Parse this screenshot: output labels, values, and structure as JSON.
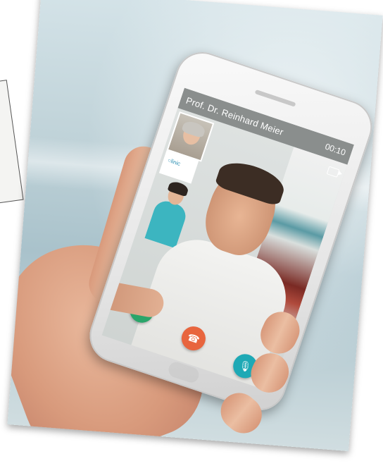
{
  "call": {
    "caller_name": "Prof. Dr. Reinhard Meier",
    "timer": "00:10"
  },
  "icons": {
    "add": "plus-icon",
    "hangup": "phone-hangup-icon",
    "mic": "microphone-icon",
    "video": "video-camera-icon"
  },
  "colors": {
    "add_button": "#2aa56a",
    "hangup_button": "#e8653e",
    "mic_button": "#1ea9b5",
    "status_bar": "#8a8e8d"
  }
}
